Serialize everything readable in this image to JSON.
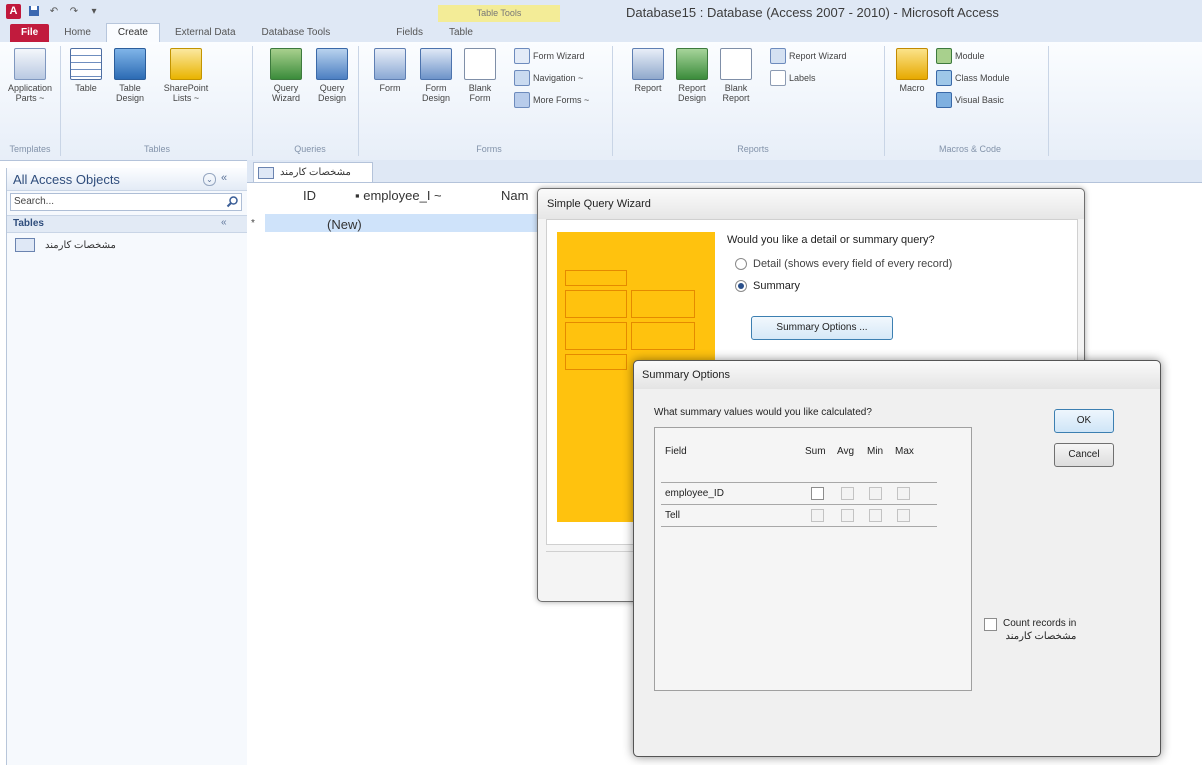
{
  "window": {
    "title": "Database15 : Database (Access 2007 - 2010) - Microsoft Access",
    "contextual_group": "Table Tools"
  },
  "quick_access": {
    "app_icon": "A",
    "icons": [
      "access-app-icon",
      "save-icon",
      "undo-icon",
      "redo-icon",
      "customize-qat-icon"
    ]
  },
  "tabs": [
    "File",
    "Home",
    "Create",
    "External Data",
    "Database Tools",
    "Fields",
    "Table"
  ],
  "ribbon": {
    "groups": {
      "templates": "Templates",
      "tables": "Tables",
      "queries": "Queries",
      "forms": "Forms",
      "reports": "Reports",
      "macros": "Macros & Code"
    },
    "buttons": {
      "application_parts": "Application\nParts ~",
      "table": "Table",
      "table_design": "Table\nDesign",
      "sharepoint_lists": "SharePoint\nLists ~",
      "query_wizard": "Query\nWizard",
      "query_design": "Query\nDesign",
      "form": "Form",
      "form_design": "Form\nDesign",
      "blank_form": "Blank\nForm",
      "form_wizard": "Form Wizard",
      "navigation": "Navigation ~",
      "more_forms": "More Forms ~",
      "report": "Report",
      "report_design": "Report\nDesign",
      "blank_report": "Blank\nReport",
      "report_wizard": "Report Wizard",
      "labels": "Labels",
      "macro": "Macro",
      "module": "Module",
      "class_module": "Class Module",
      "visual_basic": "Visual Basic"
    }
  },
  "nav_pane": {
    "title": "All Access Objects",
    "search_placeholder": "Search...",
    "section": "Tables",
    "items": [
      "مشخصات کارمند"
    ]
  },
  "document": {
    "tab_label": "مشخصات کارمند",
    "columns": [
      "ID",
      "employee_I ~",
      "Nam"
    ],
    "new_row": "(New)",
    "row_selector": "*"
  },
  "simple_query_wizard": {
    "title": "Simple Query Wizard",
    "question": "Would you like a detail or summary query?",
    "options": [
      {
        "label": "Detail (shows every field of every record)",
        "selected": false
      },
      {
        "label": "Summary",
        "selected": true
      }
    ],
    "summary_options_button": "Summary Options ..."
  },
  "summary_options": {
    "title": "Summary Options",
    "question": "What summary values would you like calculated?",
    "columns": [
      "Field",
      "Sum",
      "Avg",
      "Min",
      "Max"
    ],
    "rows": [
      {
        "field": "employee_ID"
      },
      {
        "field": "Tell"
      }
    ],
    "ok": "OK",
    "cancel": "Cancel",
    "count_records_line1": "Count records in",
    "count_records_line2": "مشخصات کارمند"
  }
}
